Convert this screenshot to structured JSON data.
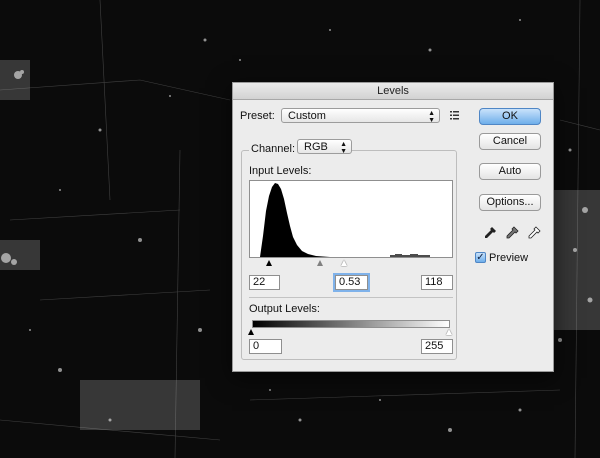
{
  "window": {
    "title": "Levels"
  },
  "preset": {
    "label": "Preset:",
    "value": "Custom",
    "menu_icon": "list-menu-icon"
  },
  "channel": {
    "label": "Channel:",
    "value": "RGB"
  },
  "input_levels": {
    "label": "Input Levels:",
    "black": "22",
    "gamma": "0.53",
    "white": "118"
  },
  "output_levels": {
    "label": "Output Levels:",
    "black": "0",
    "white": "255"
  },
  "buttons": {
    "ok": "OK",
    "cancel": "Cancel",
    "auto": "Auto",
    "options": "Options..."
  },
  "preview": {
    "label": "Preview",
    "checked": true
  },
  "eyedroppers": [
    "black-eyedropper-icon",
    "gray-eyedropper-icon",
    "white-eyedropper-icon"
  ],
  "colors": {
    "accent": "#6eaeea",
    "dialog_bg": "#ececec",
    "desktop_bg": "#0b0b0b"
  }
}
